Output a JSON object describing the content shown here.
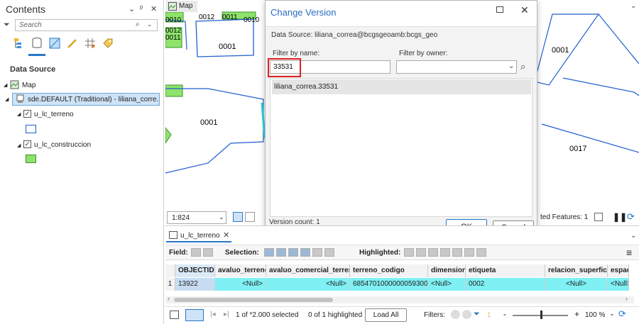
{
  "contents": {
    "title": "Contents",
    "search_placeholder": "Search",
    "data_source_label": "Data Source",
    "map_label": "Map",
    "source_item": "sde.DEFAULT (Traditional) - liliana_corre...",
    "layers": [
      {
        "name": "u_lc_terreno",
        "swatch": "#ffffff",
        "stroke": "#1f5fd1"
      },
      {
        "name": "u_lc_construccion",
        "swatch": "#8ee36b",
        "stroke": "#3b8f2a"
      }
    ]
  },
  "map": {
    "tab_label": "Map",
    "labels": [
      "0010",
      "0012",
      "0011",
      "0010",
      "0012",
      "0011",
      "0001",
      "0001",
      "0001",
      "0017"
    ],
    "scale": "1:824",
    "selected_features": "ted Features: 1"
  },
  "dialog": {
    "title": "Change Version",
    "data_source": "Data Source:  liliana_correa@bcgsgeoamb:bcgs_geo",
    "filter_name_label": "Filter by name:",
    "filter_name_value": "33531",
    "filter_owner_label": "Filter by owner:",
    "filter_owner_value": "",
    "results": [
      "liliana_correa.33531"
    ],
    "version_count": "Version count: 1",
    "ok": "OK",
    "cancel": "Cancel",
    "highlight_color": "#e02020"
  },
  "table": {
    "tab_label": "u_lc_terreno",
    "field_label": "Field:",
    "selection_label": "Selection:",
    "highlighted_label": "Highlighted:",
    "columns": [
      "OBJECTID *",
      "avaluo_terreno",
      "avaluo_comercial_terreno",
      "terreno_codigo",
      "dimension",
      "etiqueta",
      "relacion_superficie",
      "espaci"
    ],
    "row_number": "1",
    "row": [
      "13922",
      "<Null>",
      "<Null>",
      "6854701000000059300...",
      "<Null>",
      "0002",
      "<Null>",
      "<Null>"
    ],
    "footer": {
      "selected": "1 of *2.000 selected",
      "highlighted": "0 of 1 highlighted",
      "load_all": "Load All",
      "filters": "Filters:",
      "zoom": "100 %"
    }
  }
}
